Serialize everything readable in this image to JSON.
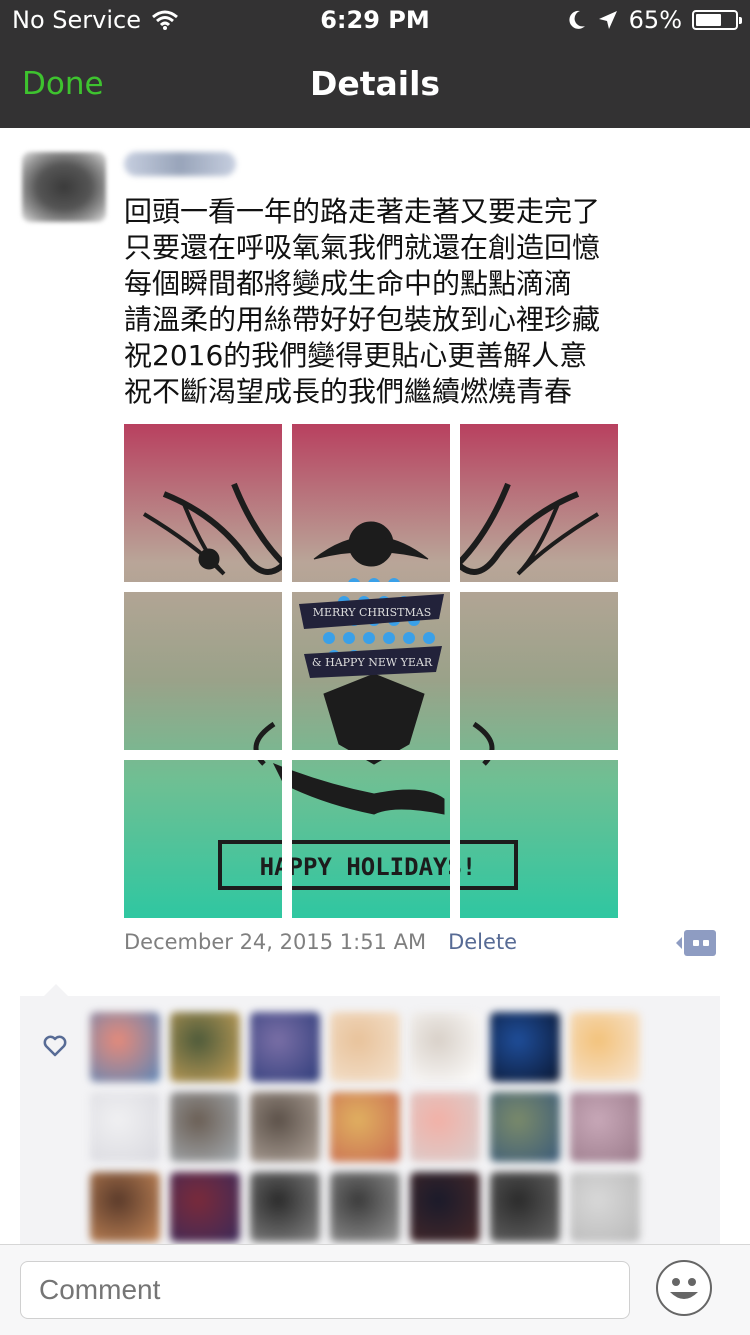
{
  "status_bar": {
    "carrier": "No Service",
    "time": "6:29 PM",
    "battery": "65%",
    "battery_level": 0.65
  },
  "nav": {
    "done_label": "Done",
    "title": "Details"
  },
  "post": {
    "text_lines": [
      "回頭一看一年的路走著走著又要走完了",
      "只要還在呼吸氧氣我們就還在創造回憶",
      "每個瞬間都將變成生命中的點點滴滴",
      "請溫柔的用絲帶好好包裝放到心裡珍藏",
      "祝2016的我們變得更貼心更善解人意",
      "祝不斷渴望成長的我們繼續燃燒青春"
    ],
    "image": {
      "banner_1": "MERRY CHRISTMAS",
      "banner_2": "& HAPPY NEW YEAR",
      "box_text": "HAPPY HOLIDAYS!"
    },
    "timestamp": "December 24, 2015 1:51 AM",
    "delete_label": "Delete"
  },
  "colors": {
    "nav_bg": "#333233",
    "done_green": "#3ec32f",
    "link_blue": "#576b95",
    "likes_bg": "#f3f3f5"
  },
  "likes_icon": "heart-outline-icon",
  "comment_bar": {
    "placeholder": "Comment",
    "emoji_icon": "smiley-icon"
  }
}
